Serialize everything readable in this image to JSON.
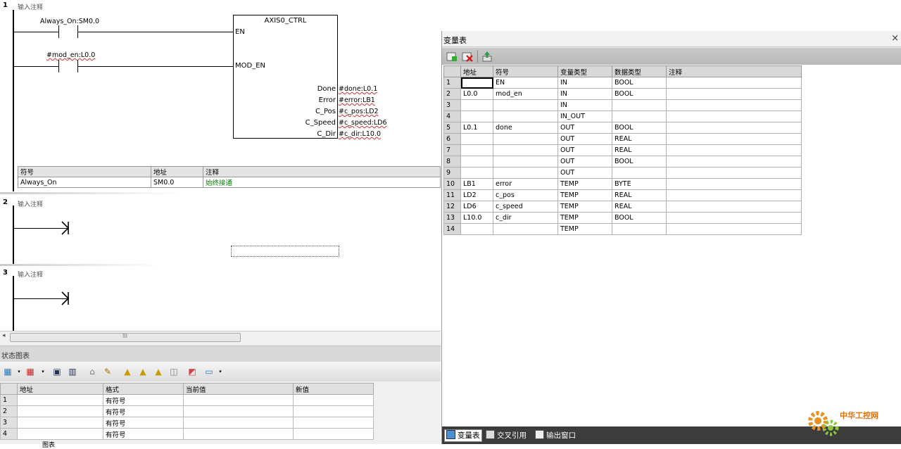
{
  "ladder": {
    "networks": [
      {
        "number": "1",
        "comment": "输入注释",
        "contacts": [
          "Always_On:SM0.0",
          "#mod_en:L0.0"
        ],
        "function_block": {
          "title": "AXIS0_CTRL",
          "inputs": [
            "EN",
            "MOD_EN"
          ],
          "outputs": [
            {
              "pin": "Done",
              "var": "#done:L0.1"
            },
            {
              "pin": "Error",
              "var": "#error:LB1"
            },
            {
              "pin": "C_Pos",
              "var": "#c_pos:LD2"
            },
            {
              "pin": "C_Speed",
              "var": "#c_speed:LD6"
            },
            {
              "pin": "C_Dir",
              "var": "#c_dir:L10.0"
            }
          ]
        },
        "symbol_table": {
          "headers": [
            "符号",
            "地址",
            "注释"
          ],
          "rows": [
            [
              "Always_On",
              "SM0.0",
              "始终接通"
            ]
          ]
        }
      },
      {
        "number": "2",
        "comment": "输入注释"
      },
      {
        "number": "3",
        "comment": "输入注释"
      }
    ],
    "scroll_grip": "III"
  },
  "status_chart": {
    "title": "状态图表",
    "headers": [
      "地址",
      "格式",
      "当前值",
      "新值"
    ],
    "rows": [
      {
        "num": "1",
        "address": "",
        "format": "有符号",
        "current": "",
        "new": ""
      },
      {
        "num": "2",
        "address": "",
        "format": "有符号",
        "current": "",
        "new": ""
      },
      {
        "num": "3",
        "address": "",
        "format": "有符号",
        "current": "",
        "new": ""
      },
      {
        "num": "4",
        "address": "",
        "format": "有符号",
        "current": "",
        "new": ""
      }
    ],
    "bottom_tab": "图表"
  },
  "variable_table": {
    "title": "变量表",
    "close_glyph": "×",
    "headers": [
      "地址",
      "符号",
      "变量类型",
      "数据类型",
      "注释"
    ],
    "rows": [
      {
        "num": "1",
        "address": "",
        "symbol": "EN",
        "var_type": "IN",
        "data_type": "BOOL",
        "comment": ""
      },
      {
        "num": "2",
        "address": "L0.0",
        "symbol": "mod_en",
        "var_type": "IN",
        "data_type": "BOOL",
        "comment": ""
      },
      {
        "num": "3",
        "address": "",
        "symbol": "",
        "var_type": "IN",
        "data_type": "",
        "comment": ""
      },
      {
        "num": "4",
        "address": "",
        "symbol": "",
        "var_type": "IN_OUT",
        "data_type": "",
        "comment": ""
      },
      {
        "num": "5",
        "address": "L0.1",
        "symbol": "done",
        "var_type": "OUT",
        "data_type": "BOOL",
        "comment": ""
      },
      {
        "num": "6",
        "address": "",
        "symbol": "",
        "var_type": "OUT",
        "data_type": "REAL",
        "comment": ""
      },
      {
        "num": "7",
        "address": "",
        "symbol": "",
        "var_type": "OUT",
        "data_type": "REAL",
        "comment": ""
      },
      {
        "num": "8",
        "address": "",
        "symbol": "",
        "var_type": "OUT",
        "data_type": "BOOL",
        "comment": ""
      },
      {
        "num": "9",
        "address": "",
        "symbol": "",
        "var_type": "OUT",
        "data_type": "",
        "comment": ""
      },
      {
        "num": "10",
        "address": "LB1",
        "symbol": "error",
        "var_type": "TEMP",
        "data_type": "BYTE",
        "comment": ""
      },
      {
        "num": "11",
        "address": "LD2",
        "symbol": "c_pos",
        "var_type": "TEMP",
        "data_type": "REAL",
        "comment": ""
      },
      {
        "num": "12",
        "address": "LD6",
        "symbol": "c_speed",
        "var_type": "TEMP",
        "data_type": "REAL",
        "comment": ""
      },
      {
        "num": "13",
        "address": "L10.0",
        "symbol": "c_dir",
        "var_type": "TEMP",
        "data_type": "BOOL",
        "comment": ""
      },
      {
        "num": "14",
        "address": "",
        "symbol": "",
        "var_type": "TEMP",
        "data_type": "",
        "comment": ""
      }
    ],
    "tabs": [
      "变量表",
      "交叉引用",
      "输出窗口"
    ]
  },
  "watermark": {
    "text": "中华工控网",
    "url": "gkong.com"
  },
  "icons": {
    "status_toolbar": [
      "add-row-icon",
      "dropdown-icon",
      "delete-row-icon",
      "dropdown-icon",
      "run-icon",
      "pause-icon",
      "history-icon",
      "pencil-icon",
      "lock-icon",
      "unlock-icon",
      "force-icon",
      "trend-icon",
      "chart-icon",
      "toggle-icon",
      "dropdown-icon"
    ],
    "vt_toolbar": [
      "insert-row-icon",
      "delete-row-icon",
      "export-icon"
    ]
  },
  "colors": {
    "accent": "#e07010",
    "comment_green": "#0a7a0a",
    "tab_bar": "#3c3c3c"
  }
}
